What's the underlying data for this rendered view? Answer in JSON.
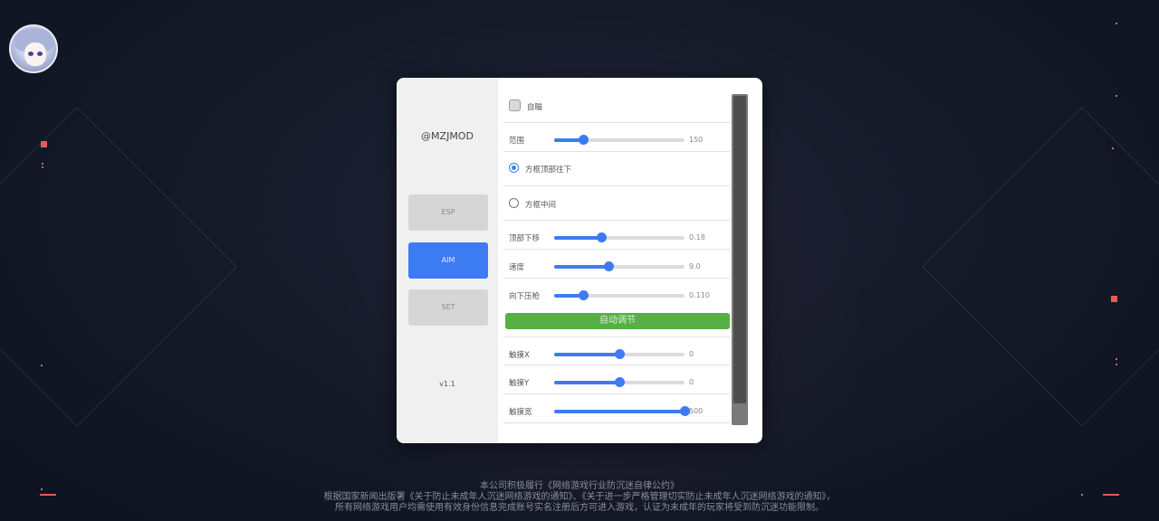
{
  "panel": {
    "brand": "@MZJMOD",
    "nav": [
      "ESP",
      "AIM",
      "SET"
    ],
    "version": "v1.1",
    "aimbot_label": "自瞄",
    "range": {
      "label": "范围",
      "value": "150",
      "fraction": 0.22
    },
    "mode_top": "方框顶部往下",
    "mode_middle": "方框中间",
    "top_down": {
      "label": "顶部下移",
      "value": "0.18",
      "fraction": 0.36
    },
    "speed": {
      "label": "速度",
      "value": "9.0",
      "fraction": 0.42
    },
    "recoil": {
      "label": "向下压枪",
      "value": "0.110",
      "fraction": 0.22
    },
    "auto_adjust": "自动调节",
    "touch_x": {
      "label": "触摸X",
      "value": "0",
      "fraction": 0.5
    },
    "touch_y": {
      "label": "触摸Y",
      "value": "0",
      "fraction": 0.5
    },
    "touch_w": {
      "label": "触摸宽",
      "value": "500",
      "fraction": 1.0
    }
  },
  "footer": {
    "line1": "本公司积极履行《网络游戏行业防沉迷自律公约》",
    "line2": "根据国家新闻出版署《关于防止未成年人沉迷网络游戏的通知》、《关于进一步严格管理切实防止未成年人沉迷网络游戏的通知》，",
    "line3": "所有网络游戏用户均需使用有效身份信息完成账号实名注册后方可进入游戏，认证为未成年的玩家将受到防沉迷功能限制。"
  },
  "colors": {
    "accent": "#3d7bf2",
    "green": "#57b045",
    "deco_red": "#e25b5b"
  }
}
